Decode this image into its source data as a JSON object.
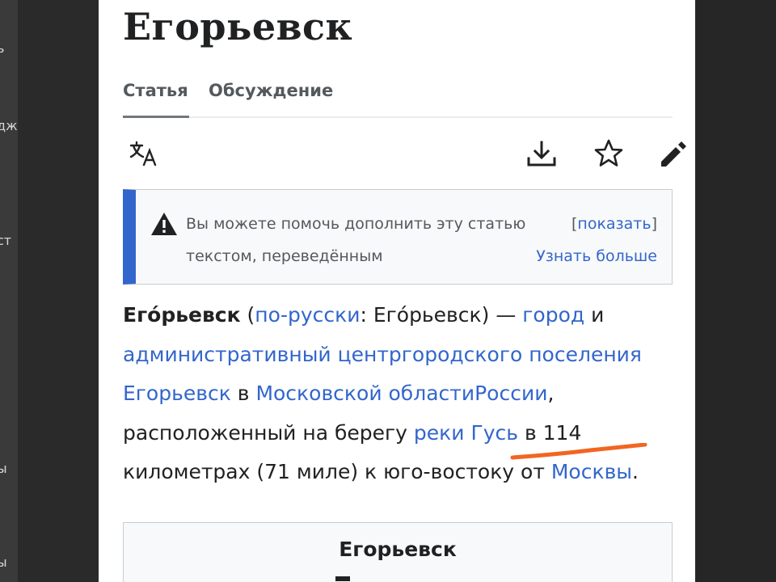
{
  "side_fragments": [
    "ь",
    "дж",
    "ст",
    "ы",
    "ы"
  ],
  "article": {
    "title": "Егорьевск",
    "tabs": {
      "article": "Статья",
      "talk": "Обсуждение"
    }
  },
  "toolbar": {
    "icons": [
      "translate-icon",
      "download-icon",
      "star-icon",
      "edit-icon"
    ]
  },
  "notice": {
    "line1": "Вы можете помочь дополнить эту статью",
    "line2": "текстом, переведённым",
    "bracket_open": "[",
    "show_link": "показать",
    "bracket_close": "]",
    "learn_more": "Узнать больше"
  },
  "body": {
    "name_bold": "Его́рьевск",
    "paren_open": " (",
    "link_russian": "по-русски",
    "russian_name": ": Его́рьевск) — ",
    "link_city": "город",
    "and": " и",
    "link_admin": "административный центргородского поселения Егорьевск",
    "in": " в ",
    "link_oblast": "Московской областиРоссии",
    "comma_located": ", расположенный на берегу ",
    "link_river": "реки Гусь",
    "distance": " в 114 километрах (71 миле) к юго-востоку от ",
    "link_moscow": "Москвы",
    "period": "."
  },
  "infobox": {
    "title": "Егорьевск"
  },
  "colors": {
    "link": "#3366cc",
    "annotation": "#f26522",
    "notice_bar": "#3366cc"
  }
}
